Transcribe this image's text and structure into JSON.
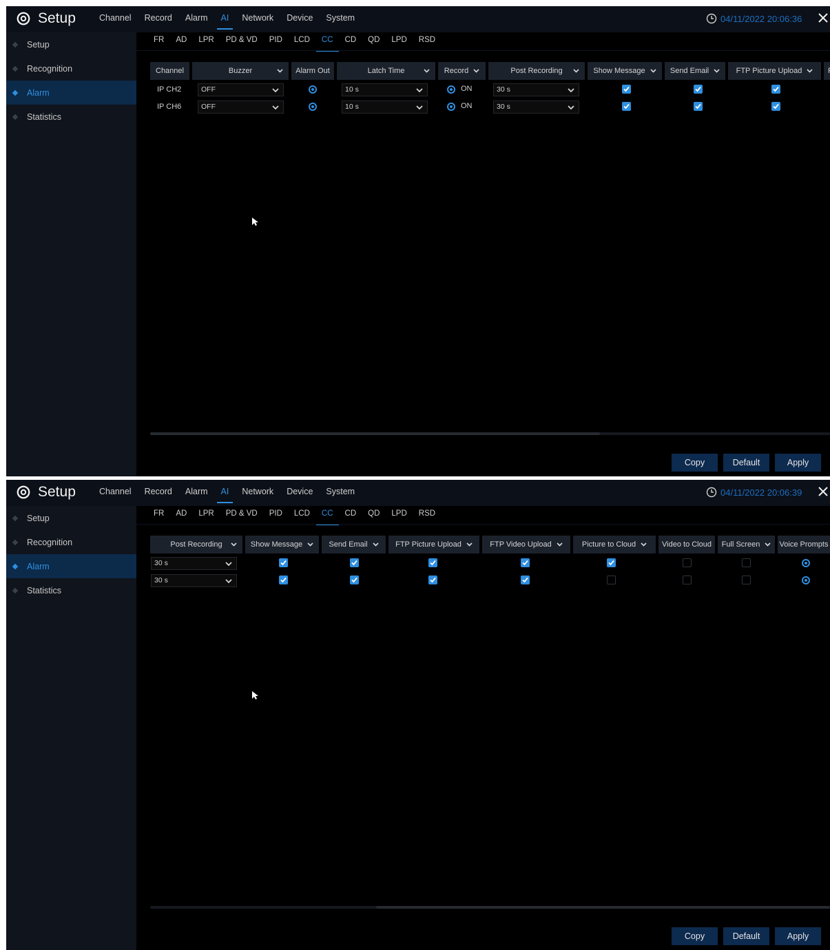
{
  "brand": {
    "title": "Setup"
  },
  "menu": [
    "Channel",
    "Record",
    "Alarm",
    "AI",
    "Network",
    "Device",
    "System"
  ],
  "menu_active": "AI",
  "sidebar": {
    "items": [
      "Setup",
      "Recognition",
      "Alarm",
      "Statistics"
    ],
    "active": "Alarm"
  },
  "subtabs": [
    "FR",
    "AD",
    "LPR",
    "PD & VD",
    "PID",
    "LCD",
    "CC",
    "CD",
    "QD",
    "LPD",
    "RSD"
  ],
  "subtab_active": "CC",
  "buttons": {
    "copy": "Copy",
    "default": "Default",
    "apply": "Apply"
  },
  "colors": {
    "accent": "#2f8fe0",
    "background": "#000000",
    "sidebar": "#10141c",
    "header": "#1c222c",
    "button": "#0d2a4f"
  },
  "screen1": {
    "clock": "04/11/2022 20:06:36",
    "headers": [
      "Channel",
      "Buzzer",
      "Alarm Out",
      "Latch Time",
      "Record",
      "Post Recording",
      "Show Message",
      "Send Email",
      "FTP Picture Upload",
      "F"
    ],
    "rows": [
      {
        "channel": "IP CH2",
        "buzzer": "OFF",
        "latch_time": "10 s",
        "record": "ON",
        "post_recording": "30 s",
        "show_message": true,
        "send_email": true,
        "ftp_picture_upload": true
      },
      {
        "channel": "IP CH6",
        "buzzer": "OFF",
        "latch_time": "10 s",
        "record": "ON",
        "post_recording": "30 s",
        "show_message": true,
        "send_email": true,
        "ftp_picture_upload": true
      }
    ]
  },
  "screen2": {
    "clock": "04/11/2022 20:06:39",
    "headers": [
      "Post Recording",
      "Show Message",
      "Send Email",
      "FTP Picture Upload",
      "FTP Video Upload",
      "Picture to Cloud",
      "Video to Cloud",
      "Full Screen",
      "Voice Prompts"
    ],
    "rows": [
      {
        "post_recording": "30 s",
        "show_message": true,
        "send_email": true,
        "ftp_picture_upload": true,
        "ftp_video_upload": true,
        "picture_to_cloud": true,
        "video_to_cloud": false,
        "full_screen": false,
        "voice_prompts": true
      },
      {
        "post_recording": "30 s",
        "show_message": true,
        "send_email": true,
        "ftp_picture_upload": true,
        "ftp_video_upload": true,
        "picture_to_cloud": false,
        "video_to_cloud": false,
        "full_screen": false,
        "voice_prompts": true
      }
    ]
  }
}
